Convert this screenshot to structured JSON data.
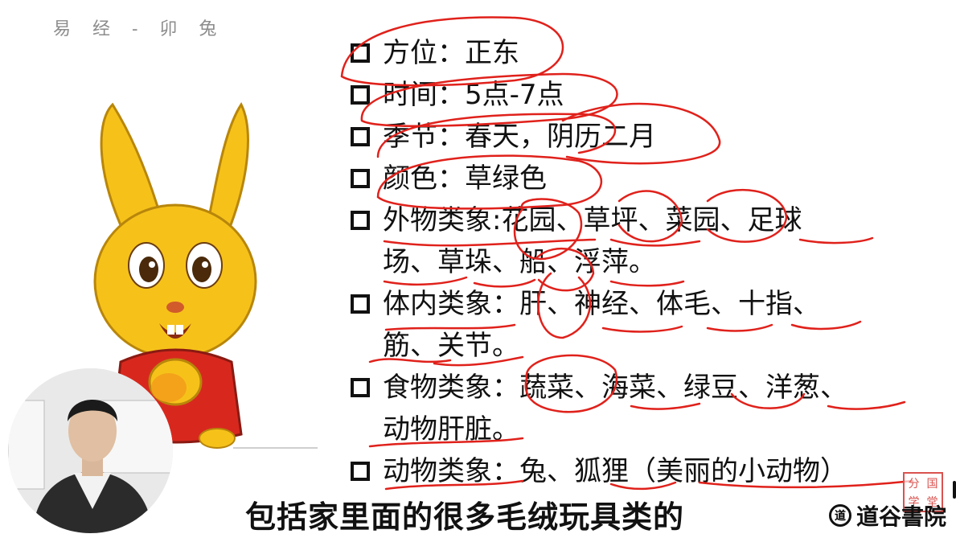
{
  "header": {
    "title": "易 经 - 卯 兔"
  },
  "slide": {
    "items": [
      {
        "label": "方位：正东"
      },
      {
        "label": "时间：5点-7点"
      },
      {
        "label": "季节：春天，阴历二月"
      },
      {
        "label": "颜色：草绿色"
      },
      {
        "label": "外物类象:花园、草坪、菜园、足球",
        "label2": "场、草垛、船、浮萍。"
      },
      {
        "label": "体内类象：肝、神经、体毛、十指、",
        "label2": "筋、关节。"
      },
      {
        "label": "食物类象：蔬菜、海菜、绿豆、洋葱、",
        "label2": "动物肝脏。"
      },
      {
        "label": "动物类象：兔、狐狸（美丽的小动物）"
      }
    ]
  },
  "subtitle": {
    "text": "包括家里面的很多毛绒玩具类的"
  },
  "watermark": {
    "icon_text": "道",
    "text": "道谷書院",
    "seal": [
      "分",
      "国",
      "学",
      "堂"
    ]
  },
  "colors": {
    "annotation": "#e0211b",
    "rabbit": "#f6c21a",
    "robe": "#d8281e"
  },
  "icons": {
    "rabbit": "rabbit-illustration",
    "checkbox": "square-bullet-icon",
    "logo": "daogu-logo-icon"
  }
}
